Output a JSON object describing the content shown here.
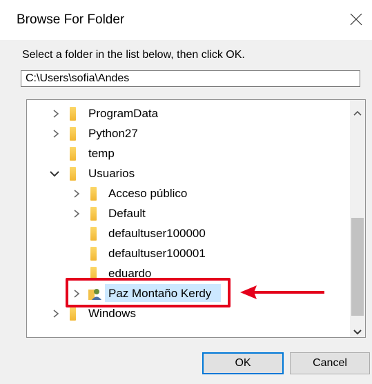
{
  "dialog": {
    "title": "Browse For Folder",
    "instruction": "Select a folder in the list below, then click OK.",
    "path_value": "C:\\Users\\sofia\\Andes",
    "ok_label": "OK",
    "cancel_label": "Cancel"
  },
  "tree": {
    "items": [
      {
        "label": "ProgramData",
        "expander": "collapsed"
      },
      {
        "label": "Python27",
        "expander": "collapsed"
      },
      {
        "label": "temp",
        "expander": "none"
      },
      {
        "label": "Usuarios",
        "expander": "expanded"
      },
      {
        "label": "Acceso público",
        "expander": "collapsed"
      },
      {
        "label": "Default",
        "expander": "collapsed"
      },
      {
        "label": "defaultuser100000",
        "expander": "none"
      },
      {
        "label": "defaultuser100001",
        "expander": "none"
      },
      {
        "label": "eduardo",
        "expander": "none"
      },
      {
        "label": "Paz Montaño Kerdy",
        "expander": "collapsed",
        "selected": true,
        "icon": "user-folder-icon"
      },
      {
        "label": "Windows",
        "expander": "collapsed"
      }
    ]
  },
  "annotation": {
    "highlight_color": "#e4001b",
    "arrow_color": "#e4001b"
  }
}
